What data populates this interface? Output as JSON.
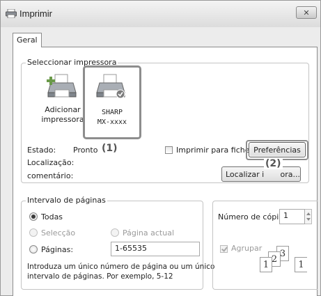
{
  "window": {
    "title": "Imprimir",
    "close_label": "✕"
  },
  "tabs": [
    {
      "label": "Geral"
    }
  ],
  "select_printer": {
    "group_label": "Seleccionar impressora",
    "printers": [
      {
        "label_line1": "Adicionar",
        "label_line2": "impressora",
        "icon": "printer-add-icon",
        "selected": false
      },
      {
        "label_line1": "SHARP",
        "label_line2": "MX-xxxx",
        "icon": "printer-default-icon",
        "selected": true
      }
    ],
    "status_label": "Estado:",
    "status_value": "Pronto",
    "location_label": "Localização:",
    "comment_label": "comentário:",
    "print_to_file_label": "Imprimir para ficheiro",
    "preferences_button": "Preferências",
    "find_printer_button": "Localizar impressora...",
    "find_printer_button_visible": "Localizar i",
    "find_printer_button_tail": "ora..."
  },
  "page_range": {
    "group_label": "Intervalo de páginas",
    "options": {
      "all": "Todas",
      "selection": "Selecção",
      "current_page": "Página actual",
      "pages": "Páginas:"
    },
    "pages_value": "1-65535",
    "hint_line1": "Introduza um único número de página ou um único",
    "hint_line2": "intervalo de páginas. Por exemplo, 5-12"
  },
  "copies": {
    "label": "Número de cópias:",
    "value": "1",
    "collate_label": "Agrupar",
    "collate_checked": true
  },
  "annotations": {
    "one": "(1)",
    "two": "(2)"
  },
  "colors": {
    "annotation_outline": "#8d8d8d",
    "window_bg": "#ececec",
    "panel_bg": "#ffffff"
  }
}
